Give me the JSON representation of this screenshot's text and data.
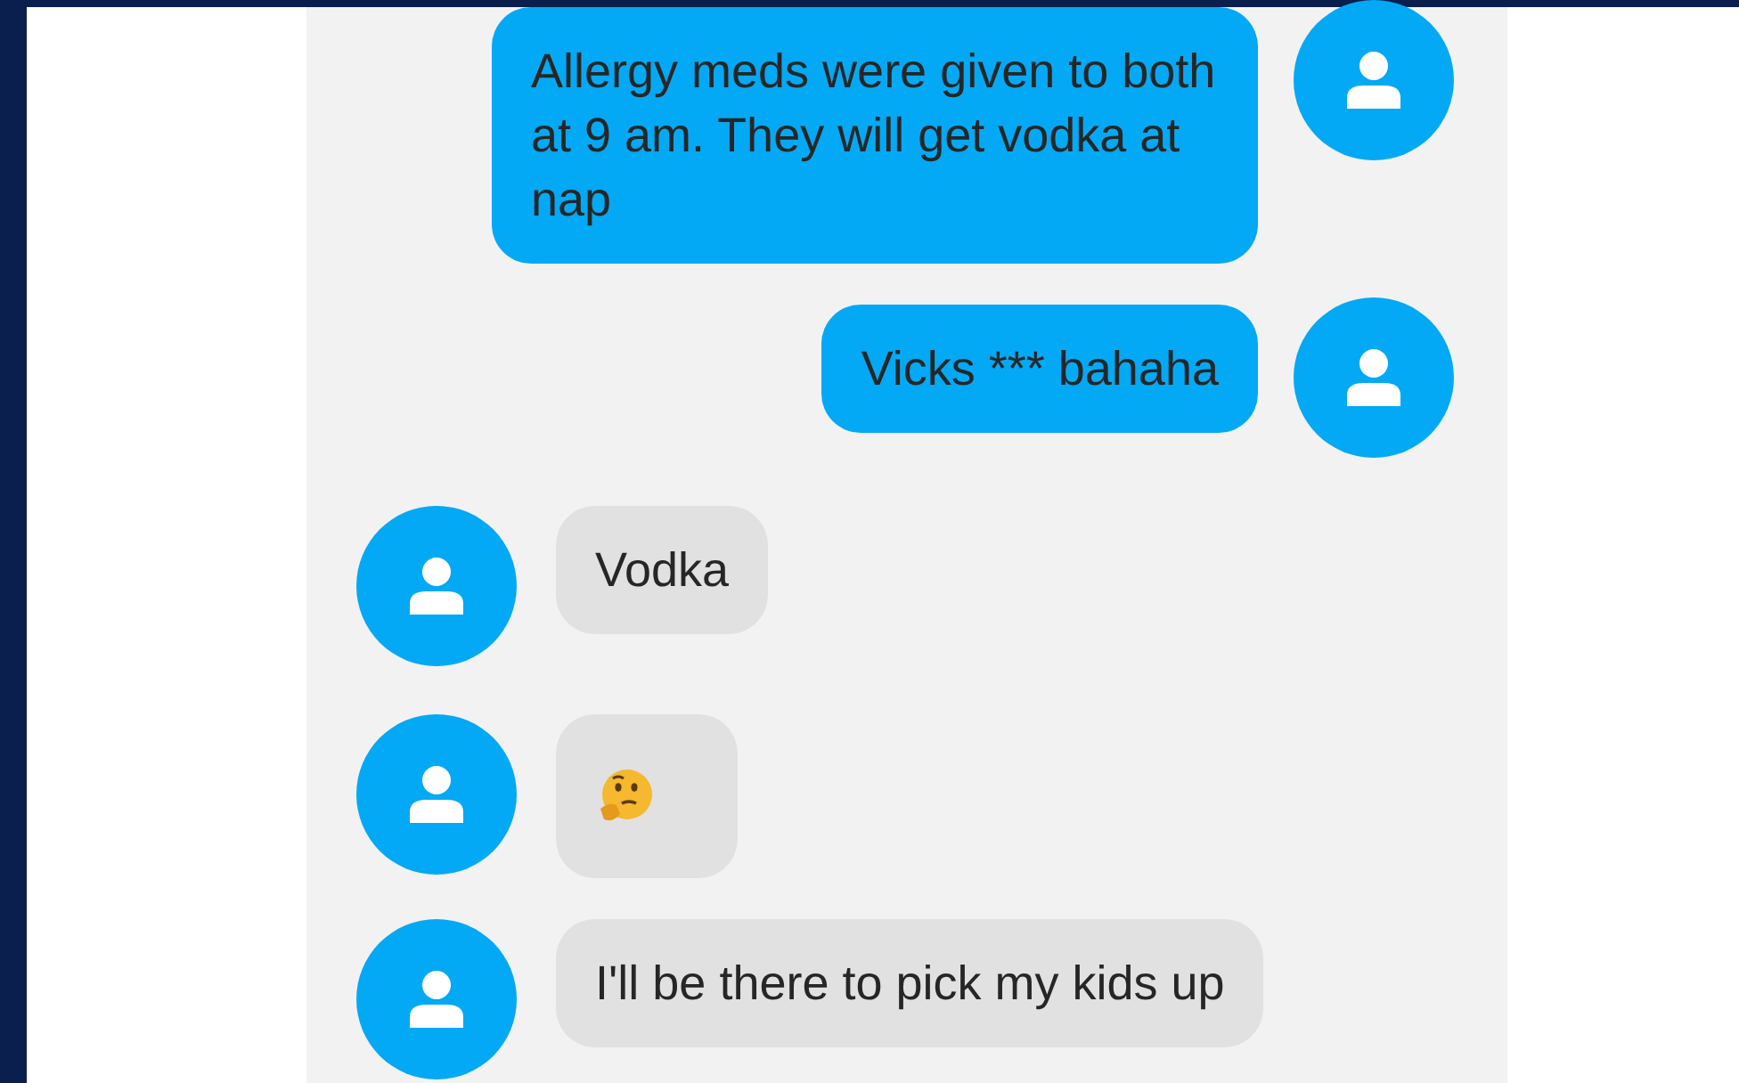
{
  "messages": [
    {
      "outgoing": true,
      "kind": "text",
      "text": "Allergy meds were given to both at 9 am. They will get vodka at nap"
    },
    {
      "outgoing": true,
      "kind": "text",
      "text": "Vicks *** bahaha"
    },
    {
      "outgoing": false,
      "kind": "text",
      "text": "Vodka"
    },
    {
      "outgoing": false,
      "kind": "emoji"
    },
    {
      "outgoing": false,
      "kind": "text",
      "text": "I'll be there to pick my kids up"
    }
  ]
}
